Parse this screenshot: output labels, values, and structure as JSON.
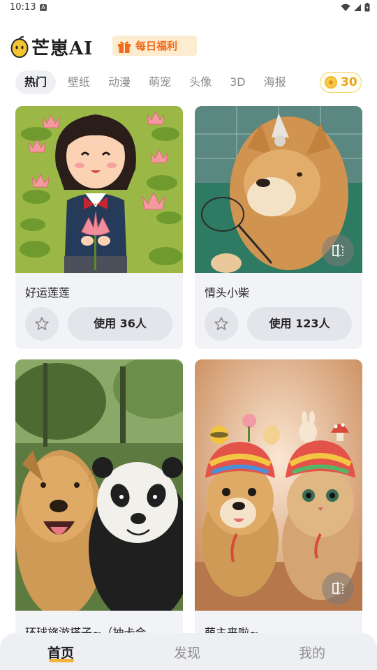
{
  "status_bar": {
    "time": "10:13",
    "notification_icon": "A",
    "icons": [
      "wifi-icon",
      "signal-icon",
      "battery-icon"
    ]
  },
  "header": {
    "app_name": "芒崽AI",
    "bonus_label": "每日福利"
  },
  "tabs": [
    {
      "label": "热门",
      "active": true
    },
    {
      "label": "壁纸",
      "active": false
    },
    {
      "label": "动漫",
      "active": false
    },
    {
      "label": "萌宠",
      "active": false
    },
    {
      "label": "头像",
      "active": false
    },
    {
      "label": "3D",
      "active": false
    },
    {
      "label": "海报",
      "active": false
    }
  ],
  "coins": {
    "count": "30",
    "icon": "coin-icon"
  },
  "cards": [
    {
      "title": "好运莲莲",
      "use_label": "使用 36人",
      "image": "cartoon-girl-lotus",
      "has_compare": false
    },
    {
      "title": "情头小柴",
      "use_label": "使用 123人",
      "image": "shiba-badminton",
      "has_compare": true
    },
    {
      "title": "环球旅游搭子~（抽卡合…",
      "image": "dog-and-panda-selfie",
      "has_compare": false
    },
    {
      "title": "萌主来啦~",
      "image": "dog-and-cat-knitted-hats",
      "has_compare": true
    }
  ],
  "bottom_nav": [
    {
      "label": "首页",
      "active": true
    },
    {
      "label": "发现",
      "active": false
    },
    {
      "label": "我的",
      "active": false
    }
  ],
  "colors": {
    "accent_orange": "#f16a1a",
    "coin_gold": "#e9a41e",
    "card_bg": "#f2f3f7",
    "nav_bg": "#eeeff3",
    "active_underline": "#f2b43a"
  }
}
